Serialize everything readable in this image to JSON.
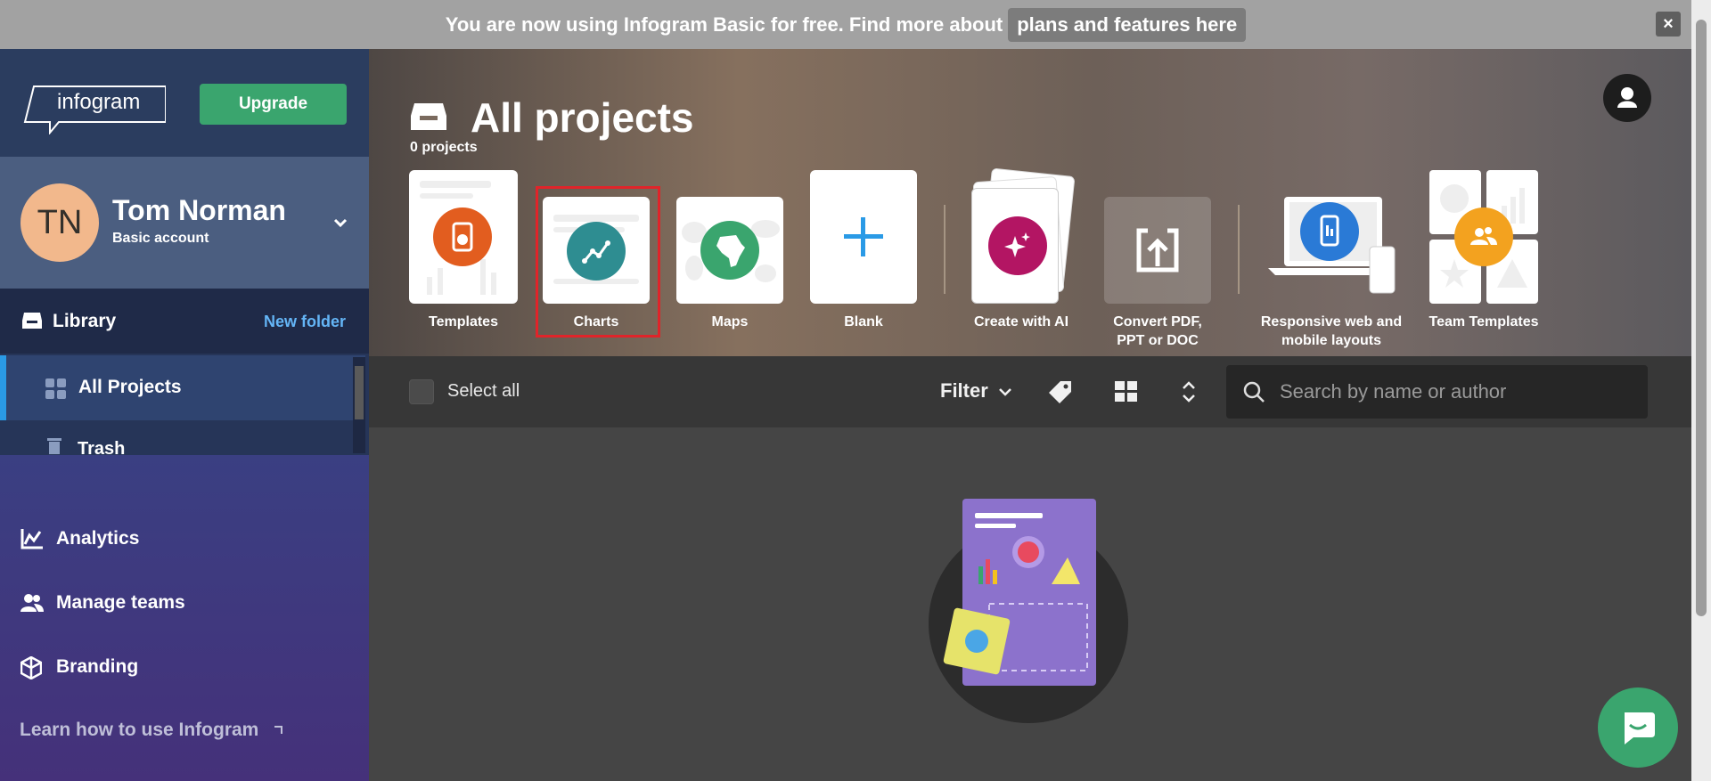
{
  "banner": {
    "text": "You are now using Infogram Basic for free. Find more about",
    "link": "plans and features here",
    "close": "×"
  },
  "sidebar": {
    "logo": "infogram",
    "upgrade": "Upgrade",
    "user": {
      "initials": "TN",
      "name": "Tom Norman",
      "account": "Basic account"
    },
    "library": {
      "label": "Library",
      "new_folder": "New folder"
    },
    "folders": [
      {
        "label": "All Projects",
        "active": true
      },
      {
        "label": "Trash",
        "active": false
      }
    ],
    "nav": [
      {
        "label": "Analytics",
        "icon": "analytics-icon"
      },
      {
        "label": "Manage teams",
        "icon": "teams-icon"
      },
      {
        "label": "Branding",
        "icon": "cube-icon"
      }
    ],
    "learn": "Learn how to use Infogram",
    "learn_icon": "external-link-icon"
  },
  "hero": {
    "title": "All projects",
    "count": "0 projects",
    "tiles": [
      {
        "label": "Templates",
        "icon": "templates-icon",
        "color": "#e25d1f"
      },
      {
        "label": "Charts",
        "icon": "chart-line-icon",
        "color": "#2e8d91",
        "selected": true
      },
      {
        "label": "Maps",
        "icon": "africa-map-icon",
        "color": "#3aa56e"
      },
      {
        "label": "Blank",
        "icon": "plus-icon",
        "color": "#2a9ae6"
      },
      {
        "label": "Create with AI",
        "icon": "sparkles-icon",
        "color": "#b31563"
      },
      {
        "label": "Convert PDF, PPT or DOC",
        "line1": "Convert PDF,",
        "line2": "PPT or DOC",
        "icon": "upload-icon"
      },
      {
        "label": "Responsive web and mobile layouts",
        "line1": "Responsive web and",
        "line2": "mobile layouts",
        "icon": "devices-icon",
        "color": "#2a7ad6"
      },
      {
        "label": "Team Templates",
        "icon": "team-icon",
        "color": "#f3a21f"
      }
    ]
  },
  "toolbar": {
    "select_all": "Select all",
    "filter": "Filter",
    "search_placeholder": "Search by name or author"
  },
  "colors": {
    "accent_green": "#3aa56e",
    "accent_blue": "#2a9ae6",
    "highlight": "#e0242a"
  }
}
